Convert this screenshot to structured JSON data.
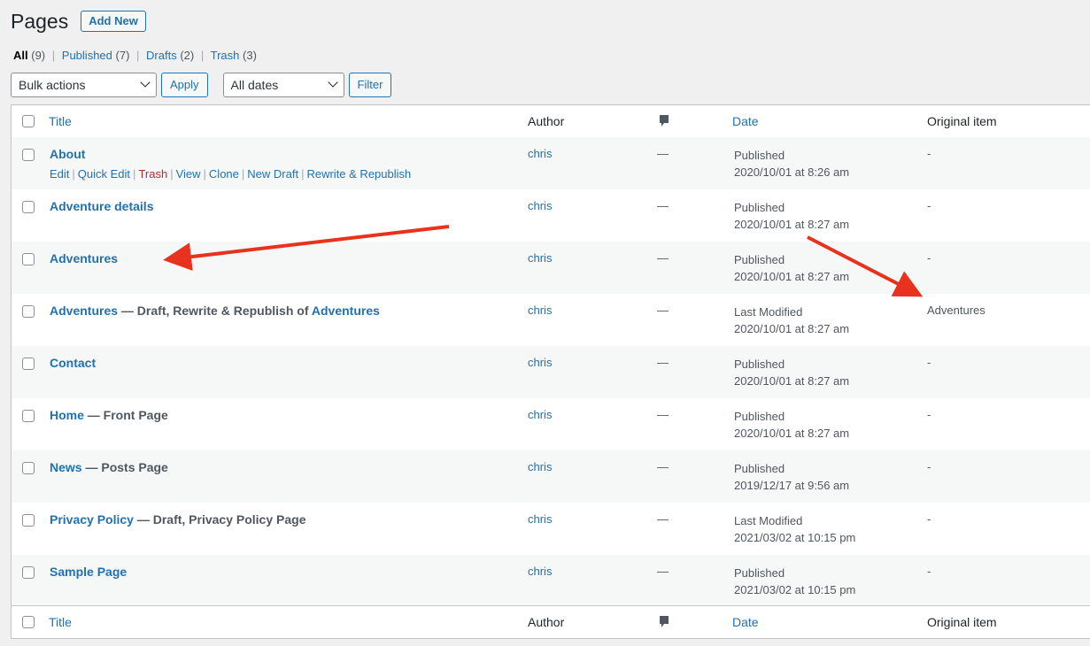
{
  "header": {
    "title": "Pages",
    "add_new": "Add New"
  },
  "views": [
    {
      "label": "All",
      "count": "(9)"
    },
    {
      "label": "Published",
      "count": "(7)"
    },
    {
      "label": "Drafts",
      "count": "(2)"
    },
    {
      "label": "Trash",
      "count": "(3)"
    }
  ],
  "tablenav": {
    "bulk_actions": "Bulk actions",
    "apply": "Apply",
    "dates": "All dates",
    "filter": "Filter"
  },
  "columns": {
    "title": "Title",
    "author": "Author",
    "date": "Date",
    "original": "Original item"
  },
  "row_actions": [
    "Edit",
    "Quick Edit",
    "Trash",
    "View",
    "Clone",
    "New Draft",
    "Rewrite & Republish"
  ],
  "rows": [
    {
      "title": "About",
      "suffix": "",
      "author": "chris",
      "comments": "—",
      "status": "Published",
      "date": "2020/10/01 at 8:26 am",
      "original": "-"
    },
    {
      "title": "Adventure details",
      "suffix": "",
      "author": "chris",
      "comments": "—",
      "status": "Published",
      "date": "2020/10/01 at 8:27 am",
      "original": "-"
    },
    {
      "title": "Adventures",
      "suffix": "",
      "author": "chris",
      "comments": "—",
      "status": "Published",
      "date": "2020/10/01 at 8:27 am",
      "original": "-"
    },
    {
      "title": "Adventures",
      "suffix": " — Draft, Rewrite & Republish of ",
      "suffix_link": "Adventures",
      "author": "chris",
      "comments": "—",
      "status": "Last Modified",
      "date": "2020/10/01 at 8:27 am",
      "original": "Adventures"
    },
    {
      "title": "Contact",
      "suffix": "",
      "author": "chris",
      "comments": "—",
      "status": "Published",
      "date": "2020/10/01 at 8:27 am",
      "original": "-"
    },
    {
      "title": "Home",
      "suffix": " — Front Page",
      "author": "chris",
      "comments": "—",
      "status": "Published",
      "date": "2020/10/01 at 8:27 am",
      "original": "-"
    },
    {
      "title": "News",
      "suffix": " — Posts Page",
      "author": "chris",
      "comments": "—",
      "status": "Published",
      "date": "2019/12/17 at 9:56 am",
      "original": "-"
    },
    {
      "title": "Privacy Policy",
      "suffix": " — Draft, Privacy Policy Page",
      "author": "chris",
      "comments": "—",
      "status": "Last Modified",
      "date": "2021/03/02 at 10:15 pm",
      "original": "-"
    },
    {
      "title": "Sample Page",
      "suffix": "",
      "author": "chris",
      "comments": "—",
      "status": "Published",
      "date": "2021/03/02 at 10:15 pm",
      "original": "-"
    }
  ],
  "colors": {
    "link": "#2271b1",
    "trash": "#b32d2e",
    "annotation_arrow": "#e8321d"
  },
  "icons": {
    "comments": "comment-bubble-icon",
    "select": "chevron-down-icon",
    "annotation": "red-arrow"
  }
}
